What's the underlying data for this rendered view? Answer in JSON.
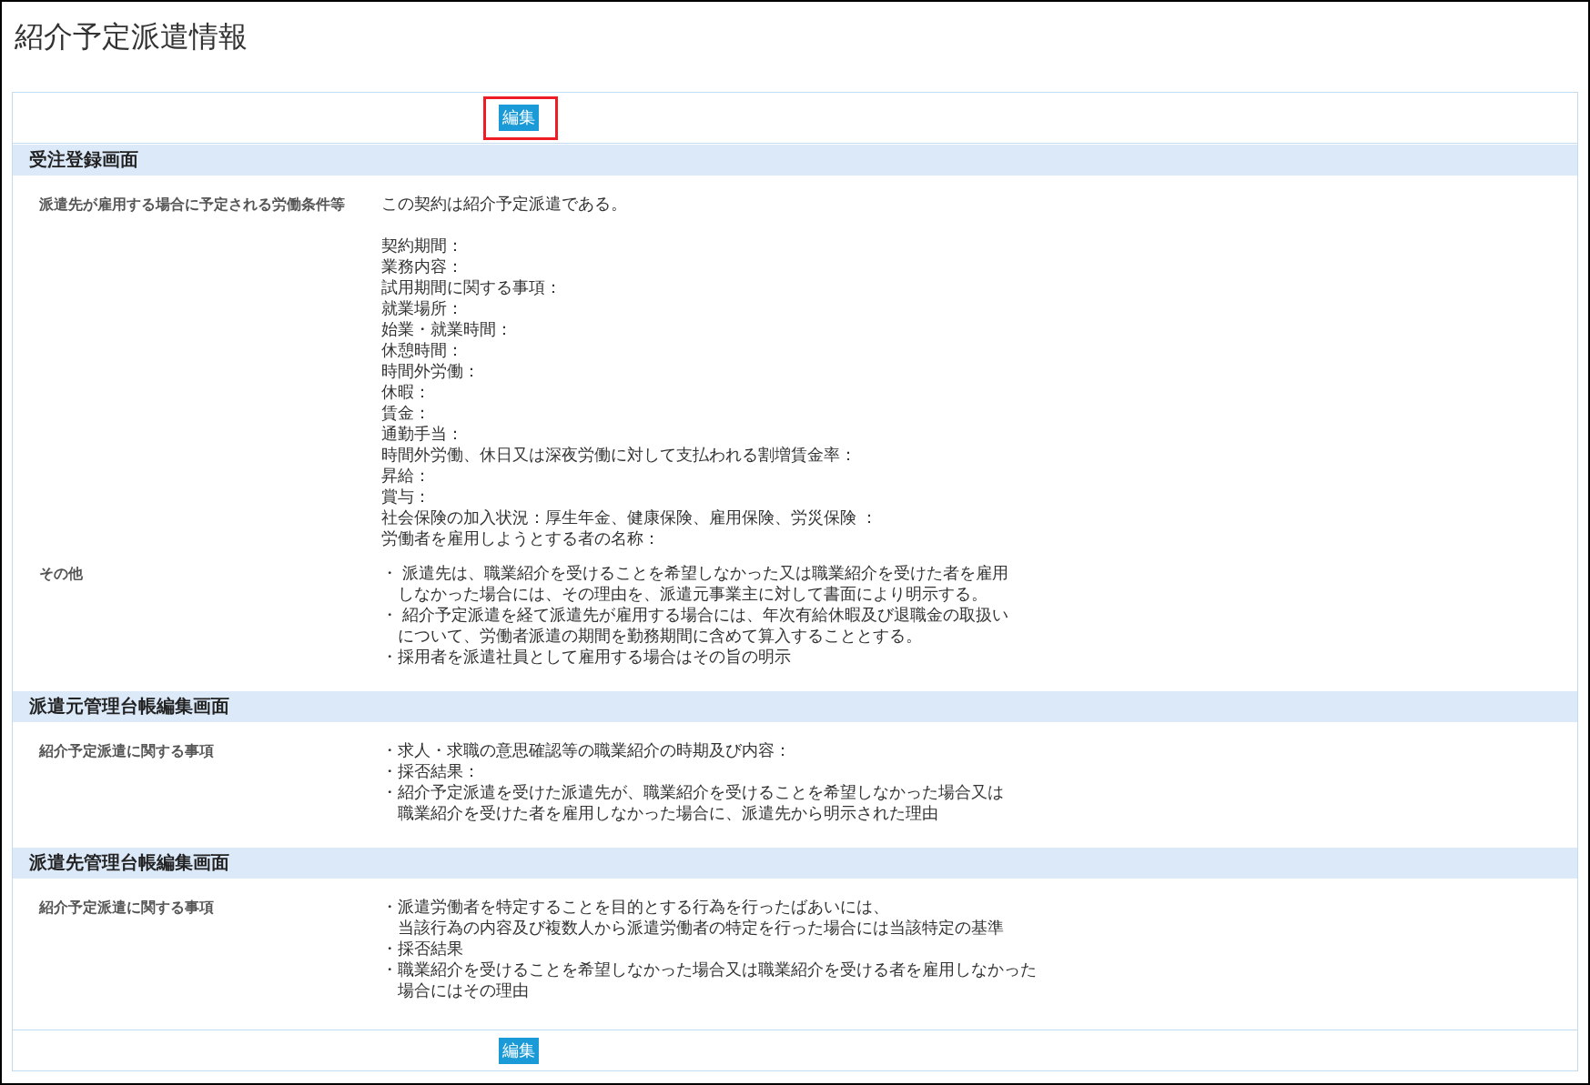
{
  "page": {
    "title": "紹介予定派遣情報"
  },
  "top_toolbar": {
    "edit_button": {
      "label": "編集",
      "highlighted": true
    }
  },
  "sections": [
    {
      "title": "受注登録画面",
      "rows": [
        {
          "label": "派遣先が雇用する場合に予定される労働条件等",
          "blocks": [
            {
              "kind": "text",
              "lines": [
                "この契約は紹介予定派遣である。"
              ]
            },
            {
              "kind": "fields",
              "lines": [
                "契約期間：",
                "業務内容：",
                "試用期間に関する事項：",
                "就業場所：",
                "始業・就業時間：",
                "休憩時間：",
                "時間外労働：",
                "休暇：",
                "賃金：",
                "通勤手当：",
                "時間外労働、休日又は深夜労働に対して支払われる割増賃金率：",
                "昇給：",
                "賞与：",
                "社会保険の加入状況：厚生年金、健康保険、雇用保険、労災保険 ：",
                "労働者を雇用しようとする者の名称："
              ]
            }
          ]
        },
        {
          "label": "その他",
          "blocks": [
            {
              "kind": "bullets",
              "items": [
                {
                  "lines": [
                    "・ 派遣先は、職業紹介を受けることを希望しなかった又は職業紹介を受けた者を雇用",
                    "しなかった場合には、その理由を、派遣元事業主に対して書面により明示する。"
                  ]
                },
                {
                  "lines": [
                    "・ 紹介予定派遣を経て派遣先が雇用する場合には、年次有給休暇及び退職金の取扱い",
                    "について、労働者派遣の期間を勤務期間に含めて算入することとする。"
                  ]
                },
                {
                  "lines": [
                    "・採用者を派遣社員として雇用する場合はその旨の明示"
                  ]
                }
              ]
            }
          ]
        }
      ]
    },
    {
      "title": "派遣元管理台帳編集画面",
      "rows": [
        {
          "label": "紹介予定派遣に関する事項",
          "blocks": [
            {
              "kind": "bullets",
              "items": [
                {
                  "lines": [
                    "・求人・求職の意思確認等の職業紹介の時期及び内容："
                  ]
                },
                {
                  "lines": [
                    "・採否結果："
                  ]
                },
                {
                  "lines": [
                    "・紹介予定派遣を受けた派遣先が、職業紹介を受けることを希望しなかった場合又は",
                    "職業紹介を受けた者を雇用しなかった場合に、派遣先から明示された理由"
                  ]
                }
              ]
            }
          ]
        }
      ]
    },
    {
      "title": "派遣先管理台帳編集画面",
      "rows": [
        {
          "label": "紹介予定派遣に関する事項",
          "blocks": [
            {
              "kind": "bullets",
              "items": [
                {
                  "lines": [
                    "・派遣労働者を特定することを目的とする行為を行ったばあいには、",
                    "当該行為の内容及び複数人から派遣労働者の特定を行った場合には当該特定の基準"
                  ]
                },
                {
                  "lines": [
                    "・採否結果"
                  ]
                },
                {
                  "lines": [
                    "・職業紹介を受けることを希望しなかった場合又は職業紹介を受ける者を雇用しなかった",
                    "場合にはその理由"
                  ]
                }
              ]
            }
          ]
        }
      ]
    }
  ],
  "bottom_toolbar": {
    "edit_button": {
      "label": "編集"
    }
  }
}
